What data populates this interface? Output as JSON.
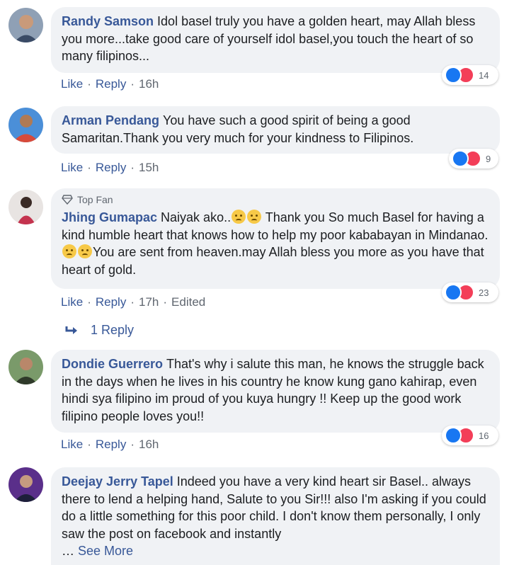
{
  "colors": {
    "name": "#385898",
    "bubble": "#f0f2f5",
    "like": "#1877f2",
    "love": "#f33e58",
    "meta": "#606770"
  },
  "comments": [
    {
      "author": "Randy Samson",
      "text": "Idol basel truly you have a golden heart, may Allah bless you more...take good care of yourself idol basel,you touch the heart of so many filipinos...",
      "reaction_count": "14",
      "like": "Like",
      "reply": "Reply",
      "time": "16h"
    },
    {
      "author": "Arman Pendang",
      "text": "You have such a good spirit of being a good Samaritan.Thank you very much for your kindness to Filipinos.",
      "reaction_count": "9",
      "like": "Like",
      "reply": "Reply",
      "time": "15h"
    },
    {
      "badge": "Top Fan",
      "author": "Jhing Gumapac",
      "text_a": "Naiyak ako..",
      "text_b": "Thank you So much Basel for having a kind humble heart that knows how to help my poor kababayan in Mindanao.",
      "text_c": "You are sent from heaven.may Allah bless you more as you have that heart of gold.",
      "reaction_count": "23",
      "like": "Like",
      "reply": "Reply",
      "time": "17h",
      "edited": "Edited",
      "replies_label": "1 Reply"
    },
    {
      "author": "Dondie Guerrero",
      "text": "That's why i salute this man, he knows the struggle back in the days when he lives in his country he know kung gano kahirap, even hindi sya filipino im proud of you kuya hungry !! Keep up the good work filipino people loves you!!",
      "reaction_count": "16",
      "like": "Like",
      "reply": "Reply",
      "time": "16h"
    },
    {
      "author": "Deejay Jerry Tapel",
      "text": "Indeed you have a very kind heart sir Basel.. always there to lend a helping hand, Salute to you Sir!!! also I'm asking if you could do a little something for this poor child. I don't know them personally, I only saw the post on facebook and instantly",
      "ellipsis": "…",
      "see_more": "See More"
    }
  ]
}
